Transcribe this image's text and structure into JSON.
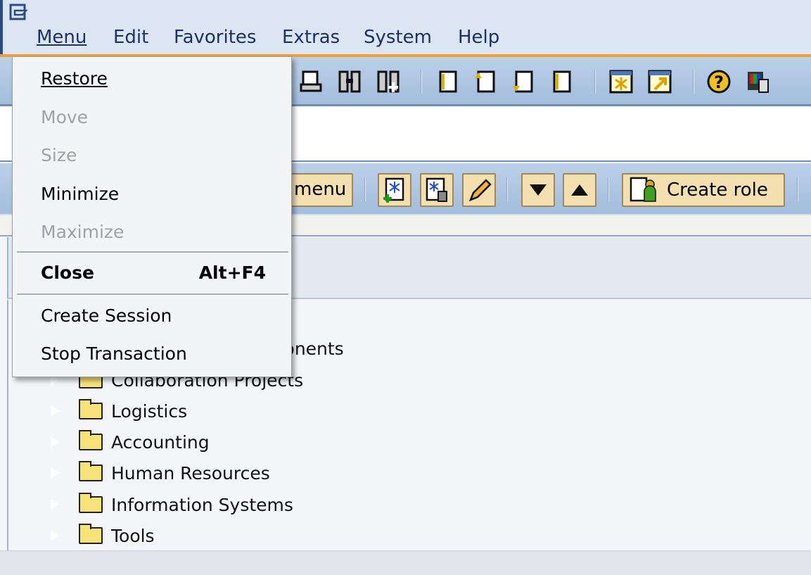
{
  "menubar": {
    "items": [
      {
        "label": "Menu"
      },
      {
        "label": "Edit"
      },
      {
        "label": "Favorites"
      },
      {
        "label": "Extras"
      },
      {
        "label": "System"
      },
      {
        "label": "Help"
      }
    ]
  },
  "system_toolbar": {
    "icons": [
      "print-icon",
      "find-icon",
      "find-next-icon",
      "first-page-icon",
      "previous-page-icon",
      "next-page-icon",
      "last-page-icon",
      "create-session-icon",
      "shortcut-icon",
      "help-icon",
      "layout-icon"
    ]
  },
  "app_toolbar": {
    "menu_button": "menu",
    "create_role": "Create role",
    "icons": [
      "add-favorite-icon",
      "delete-favorite-icon",
      "change-favorite-icon",
      "move-down-icon",
      "move-up-icon",
      "role-icon"
    ]
  },
  "tree": {
    "items": [
      "omponents",
      "Collaboration Projects",
      "Logistics",
      "Accounting",
      "Human Resources",
      "Information Systems",
      "Tools"
    ]
  },
  "dropdown": {
    "items": [
      {
        "label": "Restore",
        "enabled": true
      },
      {
        "label": "Move",
        "enabled": false
      },
      {
        "label": "Size",
        "enabled": false
      },
      {
        "label": "Minimize",
        "enabled": true
      },
      {
        "label": "Maximize",
        "enabled": false
      },
      {
        "label": "Close",
        "shortcut": "Alt+F4",
        "enabled": true,
        "bold": true
      },
      {
        "label": "Create Session",
        "enabled": true
      },
      {
        "label": "Stop Transaction",
        "enabled": true
      }
    ]
  },
  "colors": {
    "accent": "#f0a030",
    "toolbar": "#a3bddd",
    "button": "#f3dfb0"
  }
}
